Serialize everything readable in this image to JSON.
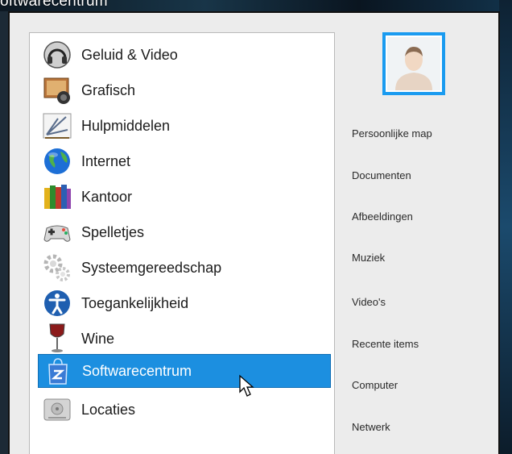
{
  "window": {
    "title_fragment": "oftwarecentrum"
  },
  "categories": [
    {
      "label": "Geluid & Video",
      "icon": "headphones-icon",
      "selected": false
    },
    {
      "label": "Grafisch",
      "icon": "graphics-icon",
      "selected": false
    },
    {
      "label": "Hulpmiddelen",
      "icon": "tools-icon",
      "selected": false
    },
    {
      "label": "Internet",
      "icon": "globe-icon",
      "selected": false
    },
    {
      "label": "Kantoor",
      "icon": "books-icon",
      "selected": false
    },
    {
      "label": "Spelletjes",
      "icon": "gamepad-icon",
      "selected": false
    },
    {
      "label": "Systeemgereedschap",
      "icon": "gears-icon",
      "selected": false
    },
    {
      "label": "Toegankelijkheid",
      "icon": "accessibility-icon",
      "selected": false
    },
    {
      "label": "Wine",
      "icon": "wine-glass-icon",
      "selected": false
    },
    {
      "label": "Softwarecentrum",
      "icon": "software-center-icon",
      "selected": true
    },
    {
      "label": "Locaties",
      "icon": "drive-icon",
      "selected": false
    }
  ],
  "places": [
    {
      "label": "Persoonlijke map"
    },
    {
      "label": "Documenten"
    },
    {
      "label": "Afbeeldingen"
    },
    {
      "label": "Muziek"
    },
    {
      "label": "Video's"
    },
    {
      "label": "Recente items"
    },
    {
      "label": "Computer"
    },
    {
      "label": "Netwerk"
    }
  ],
  "colors": {
    "selection": "#1c8fe0",
    "avatar_border": "#1a9bf0"
  }
}
